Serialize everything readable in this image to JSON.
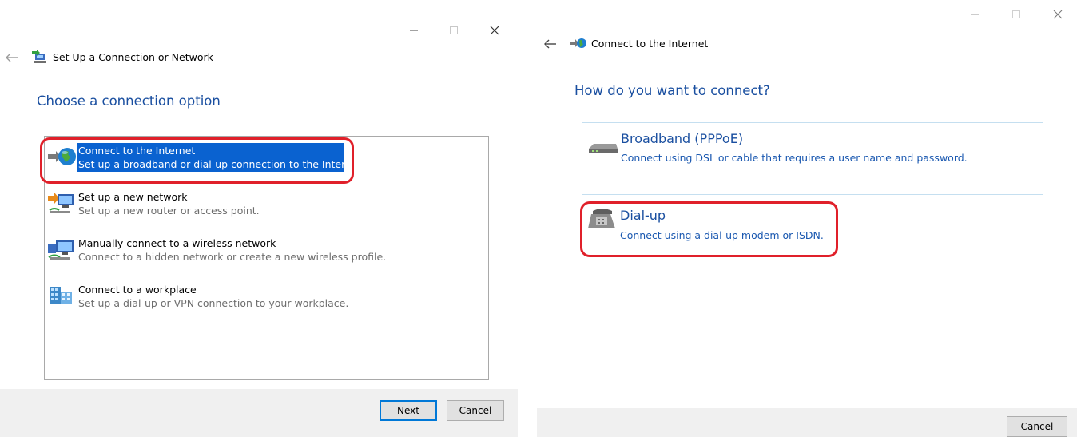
{
  "left_window": {
    "title": "Set Up a Connection or Network",
    "heading": "Choose a connection option",
    "options": [
      {
        "title": "Connect to the Internet",
        "description": "Set up a broadband or dial-up connection to the Internet.",
        "icon": "globe-icon",
        "selected": true
      },
      {
        "title": "Set up a new network",
        "description": "Set up a new router or access point.",
        "icon": "network-setup-icon",
        "selected": false
      },
      {
        "title": "Manually connect to a wireless network",
        "description": "Connect to a hidden network or create a new wireless profile.",
        "icon": "wireless-network-icon",
        "selected": false
      },
      {
        "title": "Connect to a workplace",
        "description": "Set up a dial-up or VPN connection to your workplace.",
        "icon": "workplace-icon",
        "selected": false
      }
    ],
    "buttons": {
      "next": "Next",
      "cancel": "Cancel"
    }
  },
  "right_window": {
    "title": "Connect to the Internet",
    "heading": "How do you want to connect?",
    "options": [
      {
        "title": "Broadband (PPPoE)",
        "description": "Connect using DSL or cable that requires a user name and password.",
        "icon": "modem-icon"
      },
      {
        "title": "Dial-up",
        "description": "Connect using a dial-up modem or ISDN.",
        "icon": "dialup-phone-icon"
      }
    ],
    "buttons": {
      "cancel": "Cancel"
    }
  },
  "colors": {
    "heading": "#1a4fa0",
    "selection": "#0a62d0",
    "highlight_annotation": "#e0202a",
    "footer": "#f0f0f0"
  }
}
